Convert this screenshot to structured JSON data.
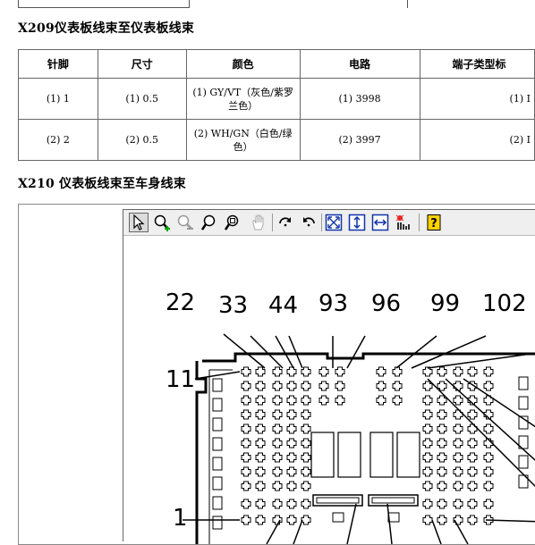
{
  "x209": {
    "title": "X209仪表板线束至仪表板线束",
    "columns": [
      "针脚",
      "尺寸",
      "颜色",
      "电路",
      "端子类型标"
    ],
    "rows": [
      {
        "pin": "(1) 1",
        "size": "(1) 0.5",
        "color": "(1) GY/VT（灰色/紫罗兰色）",
        "circuit": "(1) 3998",
        "terminal": "(1) I"
      },
      {
        "pin": "(2) 2",
        "size": "(2) 0.5",
        "color": "(2) WH/GN（白色/绿色）",
        "circuit": "(2) 3997",
        "terminal": "(2) I"
      }
    ]
  },
  "x210": {
    "title": "X210 仪表板线束至车身线束"
  },
  "viewer": {
    "tools": [
      "select-tool",
      "zoom-in",
      "zoom-out",
      "zoom-window",
      "zoom-fit",
      "pan-hand",
      "rotate-cw",
      "rotate-ccw",
      "fit-window",
      "fit-height",
      "fit-width",
      "hotspot",
      "help"
    ]
  },
  "diagram": {
    "pin_labels": [
      "22",
      "33",
      "44",
      "93",
      "96",
      "99",
      "102",
      "11",
      "1"
    ]
  }
}
